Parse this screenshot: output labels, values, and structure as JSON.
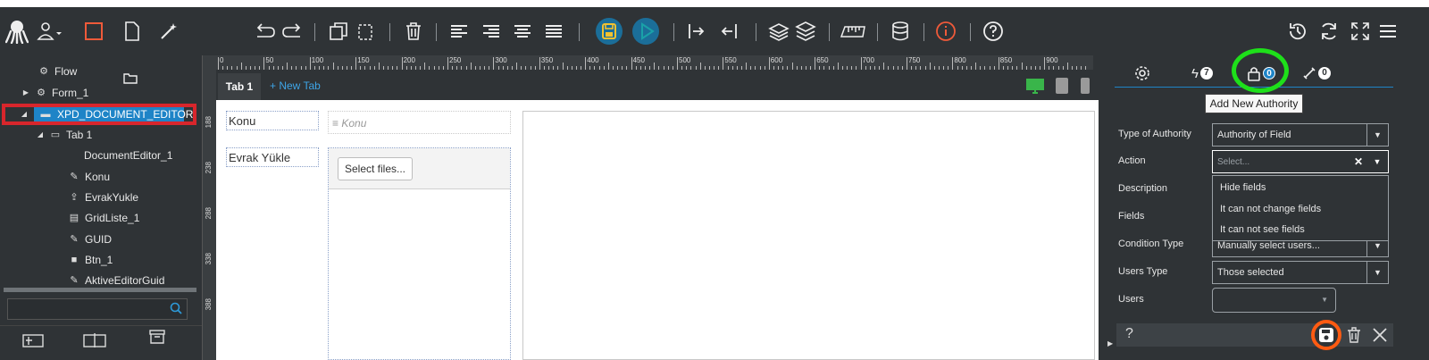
{
  "toolbar": {
    "left_icons": [
      "octopus-logo-icon",
      "user-icon",
      "square-icon",
      "file-icon",
      "magic-wand-icon"
    ],
    "edit_icons": [
      "redo-icon",
      "undo-icon",
      "copy-icon",
      "paste-icon",
      "delete-icon"
    ],
    "align_icons": [
      "align-left-icon",
      "align-right-icon",
      "align-center-icon",
      "align-justify-icon"
    ],
    "action_icons": [
      "save-icon",
      "play-icon"
    ],
    "right_icons": [
      "history-icon",
      "refresh-icon",
      "fullscreen-icon",
      "menu-icon"
    ]
  },
  "tree": {
    "items": [
      {
        "label": "Flow",
        "icon": "flow-icon"
      },
      {
        "label": "Form_1",
        "icon": "gear-icon"
      },
      {
        "label": "XPD_DOCUMENT_EDITOR",
        "icon": "form-icon"
      },
      {
        "label": "Tab 1",
        "icon": "folder-icon"
      },
      {
        "label": "DocumentEditor_1",
        "icon": ""
      },
      {
        "label": "Konu",
        "icon": "pencil-icon"
      },
      {
        "label": "EvrakYukle",
        "icon": "upload-icon"
      },
      {
        "label": "GridListe_1",
        "icon": "grid-icon"
      },
      {
        "label": "GUID",
        "icon": "pencil-icon"
      },
      {
        "label": "Btn_1",
        "icon": "square-icon"
      },
      {
        "label": "AktiveEditorGuid",
        "icon": "pencil-icon"
      }
    ],
    "search_placeholder": ""
  },
  "ruler": {
    "h_labels": [
      "0",
      "50",
      "100",
      "150",
      "200",
      "250",
      "300",
      "350",
      "400",
      "450",
      "500",
      "550",
      "600",
      "650",
      "700",
      "750",
      "800",
      "850",
      "900"
    ],
    "v_labels": [
      "188",
      "238",
      "288",
      "338",
      "388"
    ]
  },
  "tabs": {
    "active": "Tab 1",
    "new_tab": "+ New Tab"
  },
  "form": {
    "konu_label": "Konu",
    "konu_placeholder": "Konu",
    "evrak_label": "Evrak Yükle",
    "select_files": "Select files..."
  },
  "right_panel": {
    "tabs": [
      {
        "icon": "gear-icon",
        "count": ""
      },
      {
        "icon": "lightning-icon",
        "count": "7"
      },
      {
        "icon": "lock-icon",
        "count": "0"
      },
      {
        "icon": "link-icon",
        "count": "0"
      }
    ],
    "tooltip": "Add New Authority",
    "fields": {
      "type_label": "Type of Authority",
      "type_value": "Authority of Field",
      "action_label": "Action",
      "action_placeholder": "Select...",
      "description_label": "Description",
      "fields_label": "Fields",
      "condition_label": "Condition Type",
      "condition_value": "Manually select users...",
      "users_type_label": "Users Type",
      "users_type_value": "Those selected",
      "users_label": "Users"
    },
    "dropdown_options": [
      "Hide fields",
      "It can not change fields",
      "It can not see fields"
    ],
    "footer_help": "?"
  },
  "colors": {
    "background": "#2f3336",
    "accent": "#1e84c7",
    "highlight_red": "#d8262c",
    "highlight_green": "#1ee01a",
    "highlight_orange": "#ff5b12",
    "save_yellow": "#f2c230",
    "play_teal": "#1aa1a8"
  }
}
